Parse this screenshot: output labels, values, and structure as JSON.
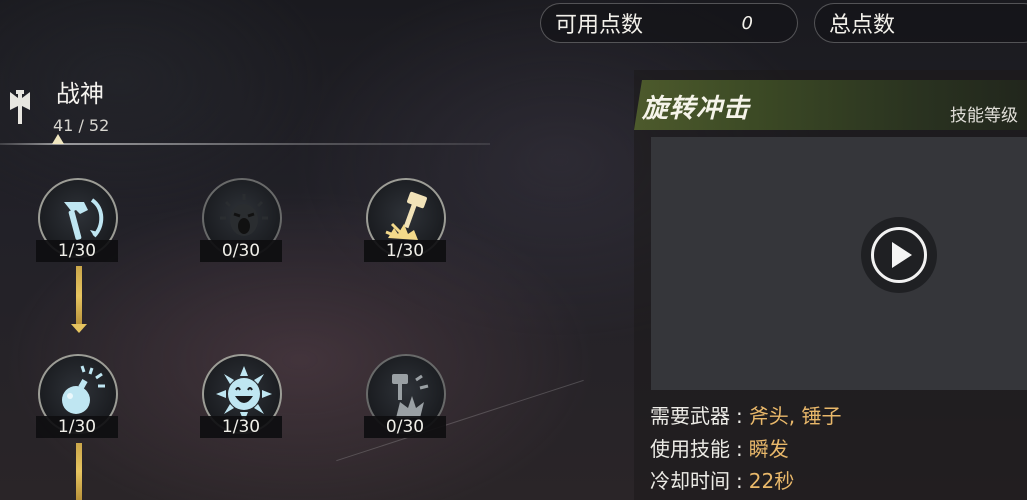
{
  "points": {
    "available_label": "可用点数",
    "available_value": "0",
    "total_label": "总点数"
  },
  "skill_class": {
    "name": "战神",
    "progress": "41 / 52",
    "icon": "battle-axe-icon"
  },
  "skills": [
    {
      "id": "spin-hammer",
      "icon": "spinning-hammer-icon",
      "level": "1/30",
      "active": true
    },
    {
      "id": "war-cry",
      "icon": "roaring-face-icon",
      "level": "0/30",
      "active": false
    },
    {
      "id": "ground-smash",
      "icon": "hammer-strike-icon",
      "level": "1/30",
      "active": true
    },
    {
      "id": "bomb",
      "icon": "bomb-burst-icon",
      "level": "1/30",
      "active": true
    },
    {
      "id": "frenzy",
      "icon": "laughing-sun-face-icon",
      "level": "1/30",
      "active": true
    },
    {
      "id": "hammer-burst",
      "icon": "hammer-burst-icon",
      "level": "0/30",
      "active": false
    }
  ],
  "detail": {
    "skill_name": "旋转冲击",
    "level_label": "技能等级",
    "weapon_label": "需要武器",
    "weapon_value": "斧头, 锤子",
    "use_label": "使用技能",
    "use_value": "瞬发",
    "cooldown_label": "冷却时间",
    "cooldown_value": "22秒",
    "separator": ":"
  },
  "colors": {
    "accent_gold": "#e6c460",
    "value_orange": "#e9b86a",
    "banner_green": "#4d5a2c",
    "icon_blue": "#bfe6f2"
  }
}
